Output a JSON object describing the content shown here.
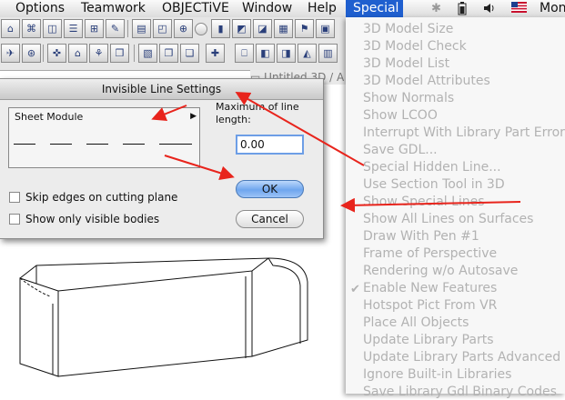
{
  "menubar": {
    "items": [
      "Options",
      "Teamwork",
      "OBJECTiVE",
      "Window",
      "Help"
    ],
    "special": "Special",
    "clock_partial": "Mon",
    "icons": [
      "bluetooth-icon",
      "battery-icon",
      "volume-icon",
      "us-flag-icon"
    ]
  },
  "document": {
    "title": "Untitled 3D / A"
  },
  "dialog": {
    "title": "Invisible Line Settings",
    "sheet_module_label": "Sheet Module",
    "max_length_label": "Maximum of line length:",
    "max_length_value": "0.00",
    "ok_label": "OK",
    "cancel_label": "Cancel",
    "skip_edges_label": "Skip edges on cutting plane",
    "skip_edges_checked": false,
    "only_visible_label": "Show only visible bodies",
    "only_visible_checked": false
  },
  "special_menu": {
    "items": [
      "3D Model Size",
      "3D Model Check",
      "3D Model List",
      "3D Model Attributes",
      "Show Normals",
      "Show LCOO",
      "Interrupt With Library Part Error M",
      "Save GDL...",
      "Special Hidden Line...",
      "Use Section Tool in 3D",
      "Show Special Lines",
      "Show All Lines on Surfaces",
      "Draw With Pen #1",
      "Frame of Perspective",
      "Rendering w/o Autosave",
      "Enable New Features",
      "Hotspot Pict From VR",
      "Place All Objects",
      "Update Library Parts",
      "Update Library Parts Advanced",
      "Ignore Built-in Libraries",
      "Save Library Gdl Binary Codes"
    ],
    "checked_item": "Enable New Features"
  },
  "colors": {
    "menu_highlight": "#1f5fcf",
    "annotation_arrow": "#e8241c",
    "disabled_text": "#b2b2b2"
  }
}
